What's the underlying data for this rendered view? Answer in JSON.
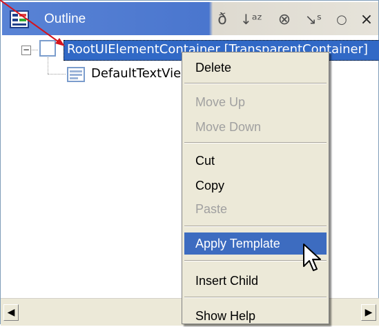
{
  "panel": {
    "title": "Outline",
    "toolbar": [
      {
        "name": "filter-icon",
        "glyph": "ð"
      },
      {
        "name": "sort-alpha-icon",
        "glyph": "↓ᵃᶻ"
      },
      {
        "name": "hide-fields-icon",
        "glyph": "⊗"
      },
      {
        "name": "hide-static-icon",
        "glyph": "↘ˢ"
      },
      {
        "name": "hide-nonpublic-icon",
        "glyph": "○"
      },
      {
        "name": "close-icon",
        "glyph": "×"
      }
    ]
  },
  "tree": {
    "root_label": "RootUIElementContainer [TransparentContainer]",
    "child_label": "DefaultTextView"
  },
  "context_menu": {
    "items": [
      {
        "label": "Delete",
        "enabled": true
      },
      {
        "label": "Move Up",
        "enabled": false
      },
      {
        "label": "Move Down",
        "enabled": false
      },
      {
        "label": "Cut",
        "enabled": true
      },
      {
        "label": "Copy",
        "enabled": true
      },
      {
        "label": "Paste",
        "enabled": false
      },
      {
        "label": "Apply Template",
        "enabled": true,
        "highlighted": true
      },
      {
        "label": "Insert Child",
        "enabled": true
      },
      {
        "label": "Show Help",
        "enabled": true
      }
    ]
  },
  "scrollbar": {
    "left_arrow": "◀",
    "right_arrow": "▶"
  },
  "colors": {
    "selection": "#3169c6",
    "menu_highlight": "#3d6cc0",
    "title_blue": "#4a76ce",
    "annotation_arrow": "#d4141d"
  }
}
